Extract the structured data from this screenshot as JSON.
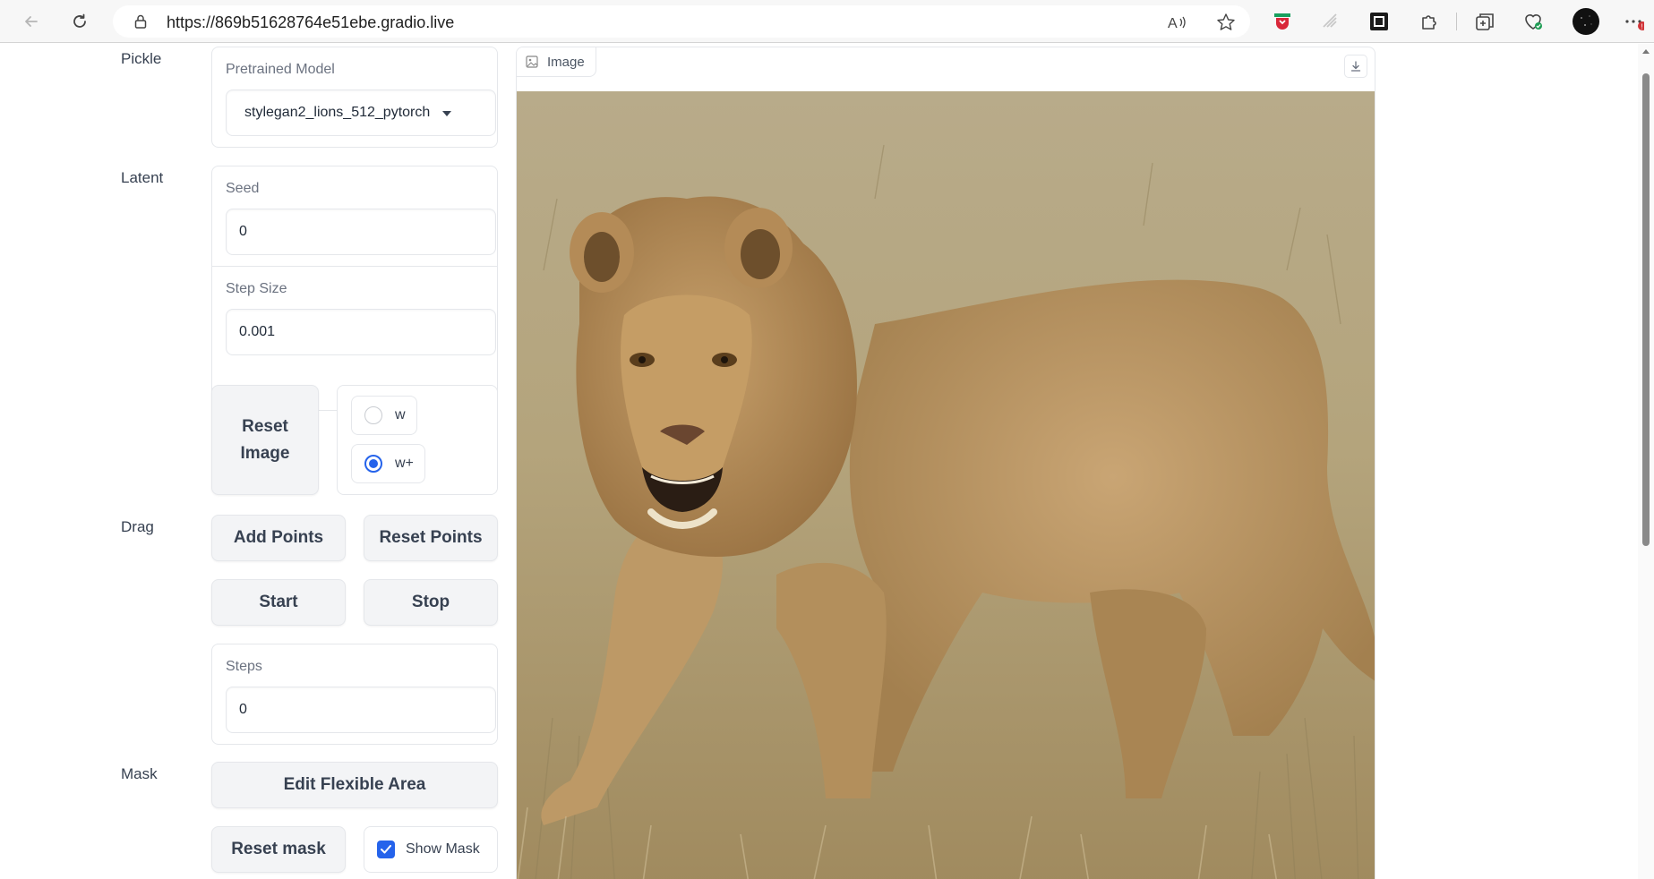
{
  "browser": {
    "url": "https://869b51628764e51ebe.gradio.live",
    "icons": [
      "back-arrow-icon",
      "refresh-icon",
      "lock-icon",
      "read-aloud-icon",
      "favorite-star-icon",
      "extension-icons",
      "split-screen-icon",
      "collections-icon",
      "browser-essentials-icon",
      "profile-avatar-icon",
      "more-menu-icon"
    ],
    "notification_badge": "!"
  },
  "sidebar_labels": {
    "pickle": "Pickle",
    "latent": "Latent",
    "drag": "Drag",
    "mask": "Mask"
  },
  "pickle": {
    "label": "Pretrained Model",
    "selected": "stylegan2_lions_512_pytorch"
  },
  "latent": {
    "seed_label": "Seed",
    "seed_value": "0",
    "step_size_label": "Step Size",
    "step_size_value": "0.001",
    "reset_image_label": "Reset Image",
    "radio_options": [
      {
        "label": "w",
        "checked": false
      },
      {
        "label": "w+",
        "checked": true
      }
    ]
  },
  "drag": {
    "add_points_label": "Add Points",
    "reset_points_label": "Reset Points",
    "start_label": "Start",
    "stop_label": "Stop",
    "steps_label": "Steps",
    "steps_value": "0"
  },
  "mask": {
    "edit_flexible_area_label": "Edit Flexible Area",
    "reset_mask_label": "Reset mask",
    "show_mask_label": "Show Mask",
    "show_mask_checked": true
  },
  "image_panel": {
    "tag_label": "Image",
    "image_description": "Young lion walking in dry grass"
  },
  "colors": {
    "accent": "#2563eb",
    "button_bg": "#f3f4f6",
    "border": "#e5e7eb"
  }
}
